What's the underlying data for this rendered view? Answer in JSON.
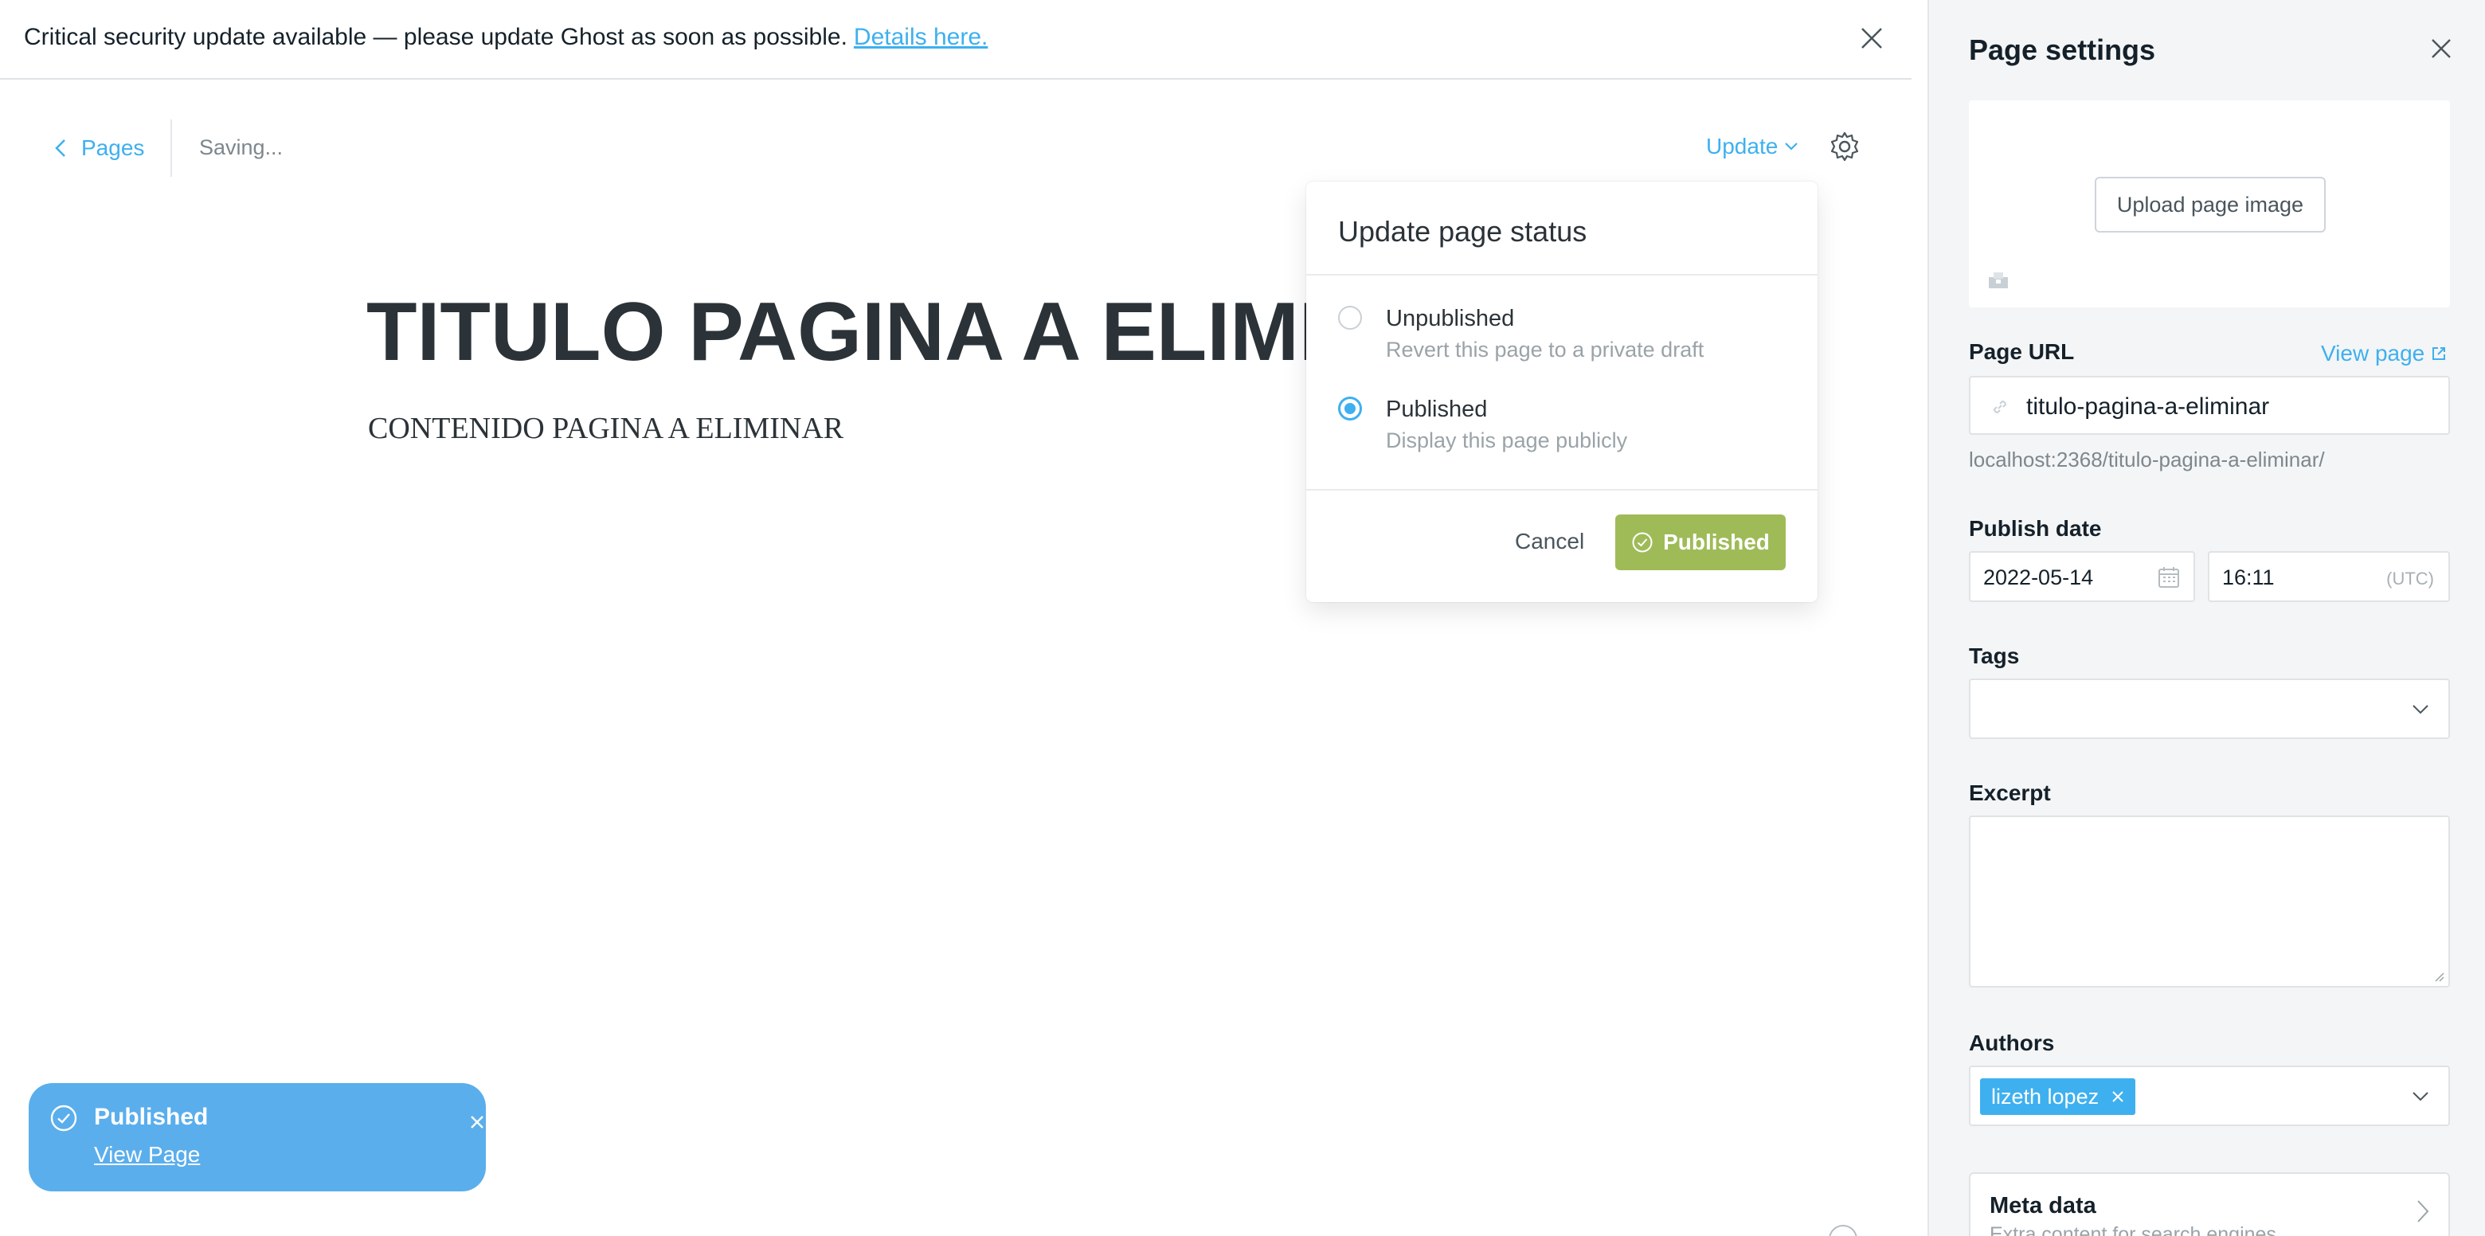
{
  "alert": {
    "message": "Critical security update available — please update Ghost as soon as possible.",
    "link_text": "Details here."
  },
  "editor": {
    "back_label": "Pages",
    "status_text": "Saving...",
    "update_label": "Update",
    "title": "TITULO PAGINA A ELIMINAR",
    "body": "CONTENIDO PAGINA A ELIMINAR"
  },
  "popover": {
    "title": "Update page status",
    "options": [
      {
        "label": "Unpublished",
        "description": "Revert this page to a private draft",
        "checked": false
      },
      {
        "label": "Published",
        "description": "Display this page publicly",
        "checked": true
      }
    ],
    "cancel_label": "Cancel",
    "confirm_label": "Published"
  },
  "toast": {
    "title": "Published",
    "link_text": "View Page"
  },
  "settings": {
    "title": "Page settings",
    "upload_label": "Upload page image",
    "url_label": "Page URL",
    "view_page_label": "View page",
    "url_value": "titulo-pagina-a-eliminar",
    "url_hint": "localhost:2368/titulo-pagina-a-eliminar/",
    "publish_date_label": "Publish date",
    "date_value": "2022-05-14",
    "time_value": "16:11",
    "timezone": "(UTC)",
    "tags_label": "Tags",
    "excerpt_label": "Excerpt",
    "authors_label": "Authors",
    "author_chip": "lizeth lopez",
    "meta_title": "Meta data",
    "meta_desc": "Extra content for search engines"
  },
  "colors": {
    "accent": "#3eb0ef",
    "publish_green": "#9fbb58",
    "toast_blue": "#5aaeec"
  },
  "icons": [
    "close-icon",
    "chevron-left-icon",
    "chevron-down-icon",
    "gear-icon",
    "check-circle-icon",
    "image-icon",
    "link-icon",
    "external-link-icon",
    "calendar-icon",
    "chevron-right-icon"
  ]
}
